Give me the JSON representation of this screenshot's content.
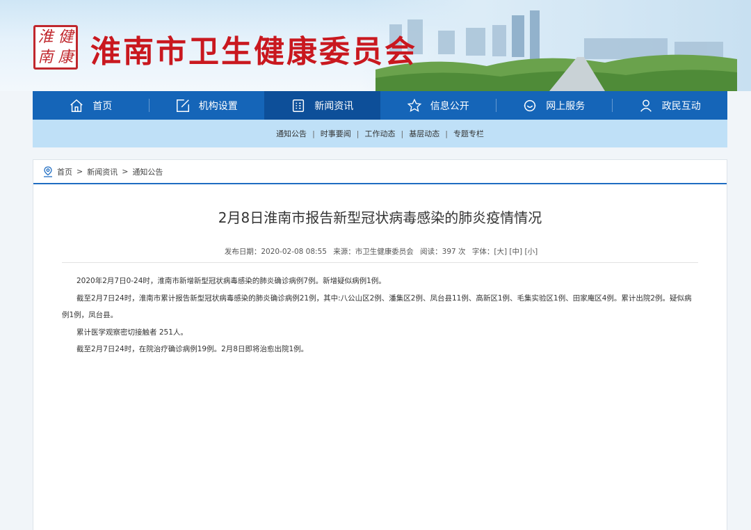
{
  "header": {
    "logo_chars": [
      "淮",
      "健",
      "南",
      "康"
    ],
    "site_title": "淮南市卫生健康委员会"
  },
  "nav": {
    "items": [
      {
        "label": "首页",
        "icon": "home-icon"
      },
      {
        "label": "机构设置",
        "icon": "edit-icon"
      },
      {
        "label": "新闻资讯",
        "icon": "news-icon"
      },
      {
        "label": "信息公开",
        "icon": "star-icon"
      },
      {
        "label": "网上服务",
        "icon": "service-icon"
      },
      {
        "label": "政民互动",
        "icon": "user-icon"
      }
    ],
    "active_index": 2
  },
  "subnav": {
    "items": [
      "通知公告",
      "时事要闻",
      "工作动态",
      "基层动态",
      "专题专栏"
    ],
    "separator": "|"
  },
  "breadcrumb": {
    "home": "首页",
    "sep": ">",
    "level1": "新闻资讯",
    "level2": "通知公告"
  },
  "article": {
    "title": "2月8日淮南市报告新型冠状病毒感染的肺炎疫情情况",
    "date_label": "发布日期：2020-02-08 08:55",
    "source_label": "来源：市卫生健康委员会",
    "views_label": "阅读：397 次",
    "font_label": "字体：",
    "font_large": "[大]",
    "font_medium": "[中]",
    "font_small": "[小]",
    "paragraphs": [
      "2020年2月7日0-24时，淮南市新增新型冠状病毒感染的肺炎确诊病例7例。新增疑似病例1例。",
      "截至2月7日24时，淮南市累计报告新型冠状病毒感染的肺炎确诊病例21例，其中:八公山区2例、潘集区2例、凤台县11例、高新区1例、毛集实验区1例、田家庵区4例。累计出院2例。疑似病例1例，凤台县。",
      "累计医学观察密切接触者 251人。",
      "截至2月7日24时，在院治疗确诊病例19例。2月8日即将治愈出院1例。"
    ]
  },
  "colors": {
    "nav_blue": "#1565b8",
    "nav_active": "#0d4f99",
    "subnav_bg": "#bfe0f7",
    "title_red": "#c9181f"
  }
}
